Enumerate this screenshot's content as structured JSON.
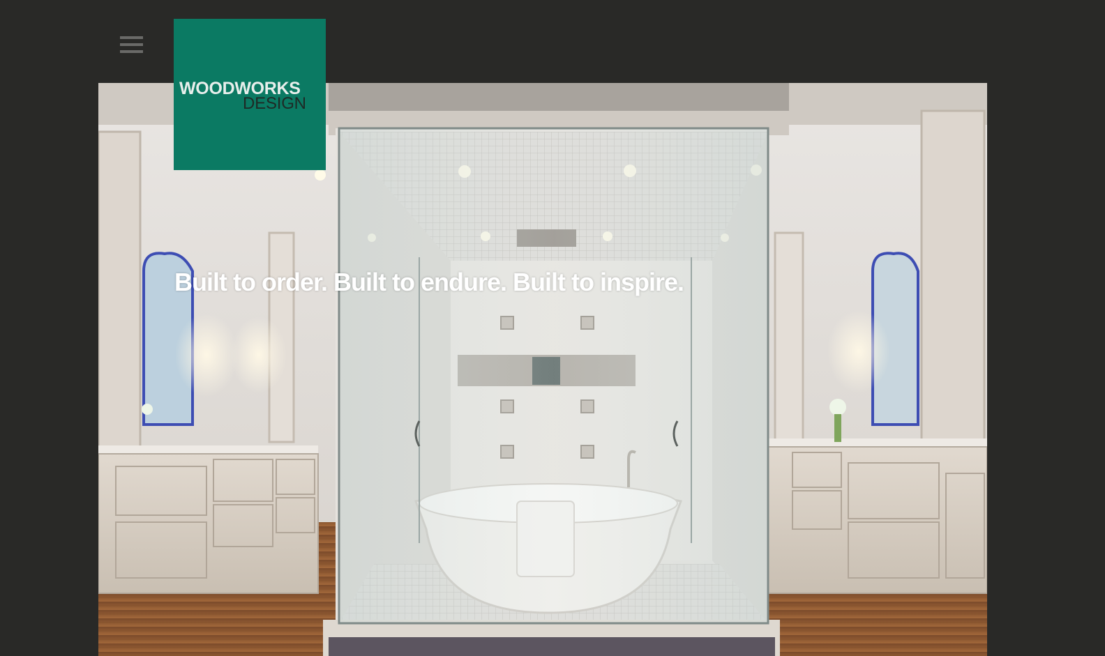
{
  "header": {
    "menu_icon": "hamburger-menu-icon",
    "logo": {
      "line1": "WOODWORKS",
      "line2": "DESIGN",
      "background_color": "#0b7a63"
    }
  },
  "hero": {
    "tagline": "Built to order. Built to endure. Built to inspire."
  },
  "colors": {
    "page_background": "#292927",
    "tagline_text": "#ffffff"
  }
}
